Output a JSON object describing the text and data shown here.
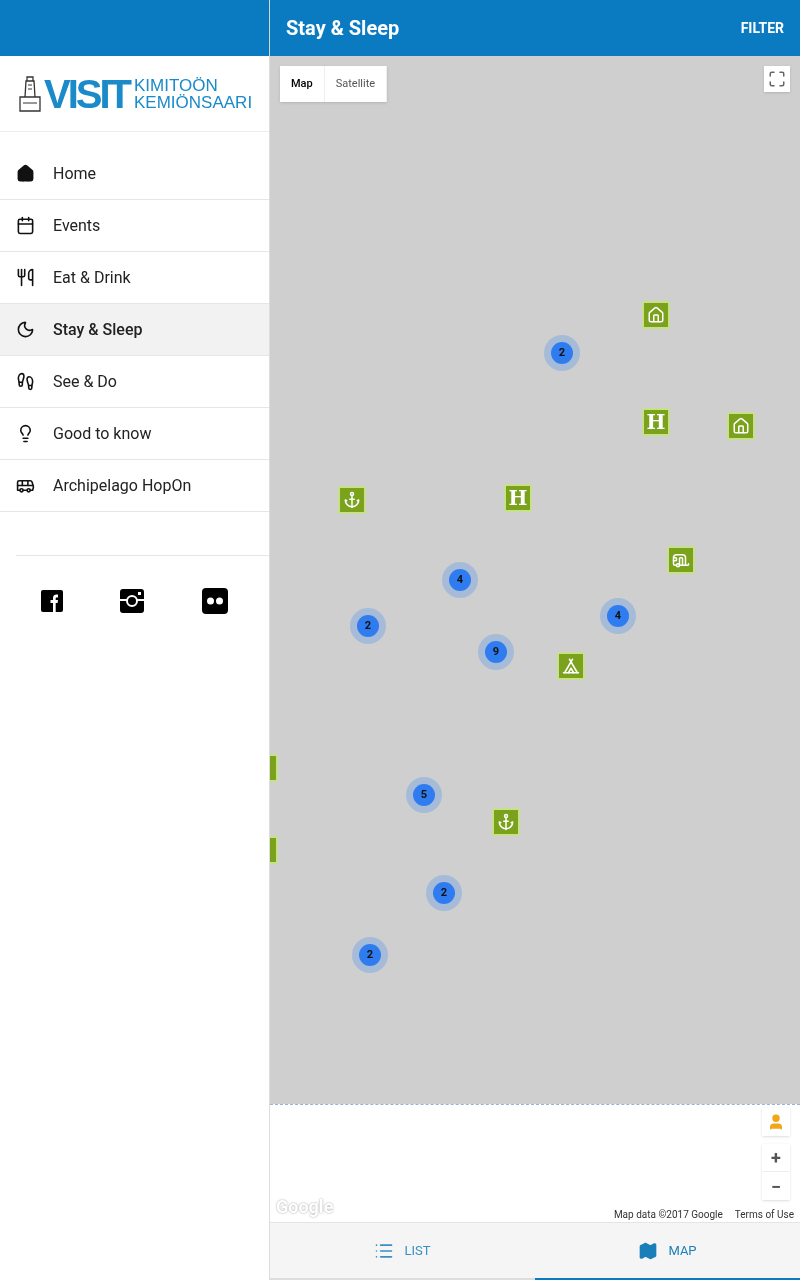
{
  "header": {
    "title": "Stay & Sleep",
    "filter": "FILTER"
  },
  "logo": {
    "visit": "VISIT",
    "line_1": "KIMITOÖN",
    "line_2": "KEMIÖNSAARI"
  },
  "nav": [
    {
      "kind": "home",
      "label": "Home",
      "selected": false
    },
    {
      "kind": "events",
      "label": "Events",
      "selected": false
    },
    {
      "kind": "eat",
      "label": "Eat & Drink",
      "selected": false
    },
    {
      "kind": "stay",
      "label": "Stay & Sleep",
      "selected": true
    },
    {
      "kind": "see",
      "label": "See & Do",
      "selected": false
    },
    {
      "kind": "know",
      "label": "Good to know",
      "selected": false
    },
    {
      "kind": "bus",
      "label": "Archipelago HopOn",
      "selected": false
    }
  ],
  "social": [
    {
      "kind": "facebook"
    },
    {
      "kind": "instagram"
    },
    {
      "kind": "flickr"
    }
  ],
  "map": {
    "types": [
      {
        "label": "Map",
        "selected": true
      },
      {
        "label": "Satellite",
        "selected": false
      }
    ],
    "clusters": [
      "2",
      "4",
      "2",
      "9",
      "4",
      "5",
      "2",
      "2"
    ],
    "pins": [
      {
        "kind": "house"
      },
      {
        "kind": "hotel",
        "label": "H"
      },
      {
        "kind": "house"
      },
      {
        "kind": "anchor"
      },
      {
        "kind": "hotel",
        "label": "H"
      },
      {
        "kind": "caravan"
      },
      {
        "kind": "cabin"
      },
      {
        "kind": "anchor"
      },
      {
        "kind": "partial"
      },
      {
        "kind": "partial"
      }
    ],
    "zoom_in": "+",
    "zoom_out": "−",
    "google": "Google",
    "attribution": "Map data ©2017 Google",
    "terms": "Terms of Use"
  },
  "view_tabs": [
    {
      "kind": "list",
      "label": "LIST",
      "selected": false
    },
    {
      "kind": "map",
      "label": "MAP",
      "selected": true
    }
  ]
}
